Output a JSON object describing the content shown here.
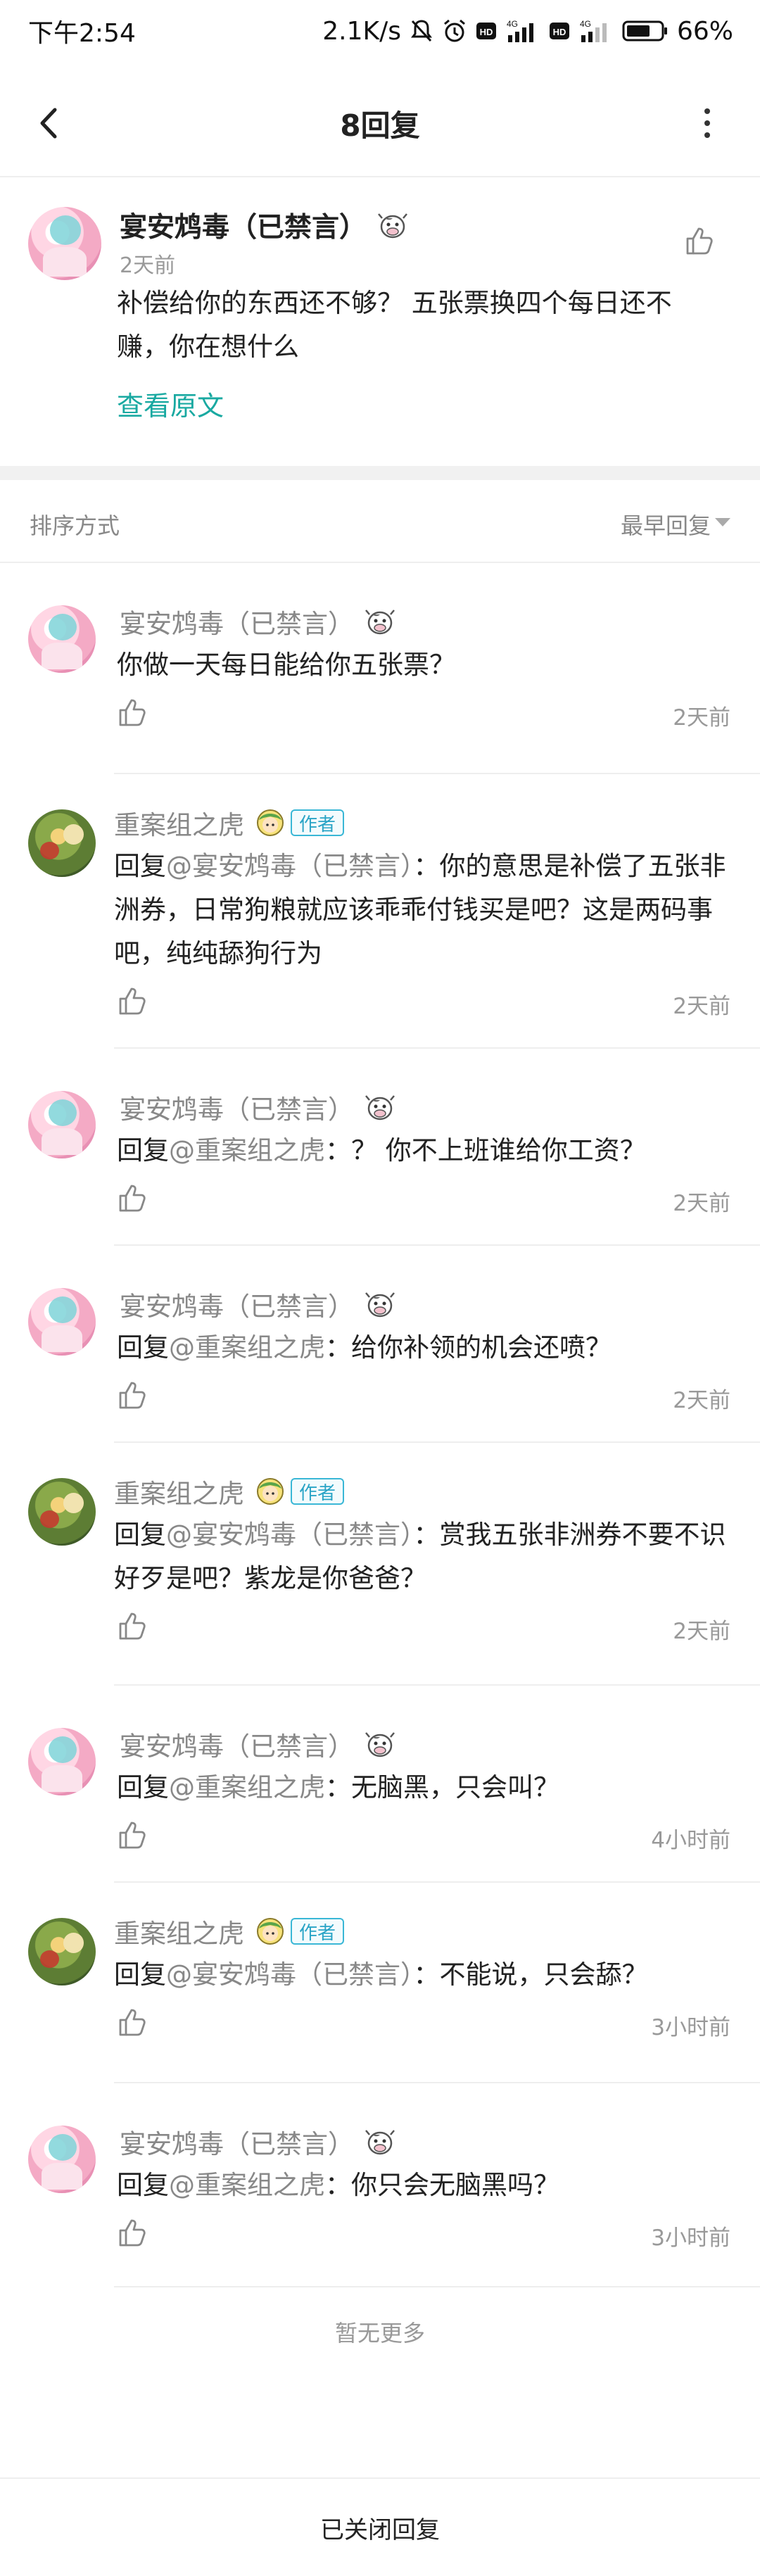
{
  "status_bar": {
    "time": "下午2:54",
    "speed": "2.1K/s",
    "battery": "66%",
    "icons": [
      "mute-icon",
      "alarm-icon",
      "hd-icon",
      "signal-4g-icon",
      "hd-icon",
      "signal-4g-icon",
      "battery-icon"
    ]
  },
  "nav": {
    "title": "8回复",
    "back_icon": "chevron-left-icon",
    "more_icon": "more-vertical-icon"
  },
  "main_comment": {
    "author": "宴安鸩毒（已禁言）",
    "time": "2天前",
    "text": "补偿给你的东西还不够？ 五张票换四个每日还不赚，你在想什么",
    "view_original": "查看原文"
  },
  "sort": {
    "label": "排序方式",
    "value": "最早回复"
  },
  "author_badge": "作者",
  "replies": [
    {
      "author": "宴安鸩毒（已禁言）",
      "prefix": "",
      "mention": "",
      "text": "你做一天每日能给你五张票？",
      "time": "2天前"
    },
    {
      "author": "重案组之虎",
      "prefix": "回复",
      "mention": "@宴安鸩毒（已禁言）",
      "text": "：你的意思是补偿了五张非洲券，日常狗粮就应该乖乖付钱买是吧？这是两码事吧，纯纯舔狗行为",
      "time": "2天前"
    },
    {
      "author": "宴安鸩毒（已禁言）",
      "prefix": "回复",
      "mention": "@重案组之虎",
      "text": "：？ 你不上班谁给你工资？",
      "time": "2天前"
    },
    {
      "author": "宴安鸩毒（已禁言）",
      "prefix": "回复",
      "mention": "@重案组之虎",
      "text": "：给你补领的机会还喷？",
      "time": "2天前"
    },
    {
      "author": "重案组之虎",
      "prefix": "回复",
      "mention": "@宴安鸩毒（已禁言）",
      "text": "：赏我五张非洲券不要不识好歹是吧？紫龙是你爸爸？",
      "time": "2天前"
    },
    {
      "author": "宴安鸩毒（已禁言）",
      "prefix": "回复",
      "mention": "@重案组之虎",
      "text": "：无脑黑，只会叫？",
      "time": "4小时前"
    },
    {
      "author": "重案组之虎",
      "prefix": "回复",
      "mention": "@宴安鸩毒（已禁言）",
      "text": "：不能说，只会舔？",
      "time": "3小时前"
    },
    {
      "author": "宴安鸩毒（已禁言）",
      "prefix": "回复",
      "mention": "@重案组之虎",
      "text": "：你只会无脑黑吗？",
      "time": "3小时前"
    }
  ],
  "no_more": "暂无更多",
  "bottom": "已关闭回复",
  "colors": {
    "accent": "#19a9a1",
    "badge": "#2aa4c6",
    "muted": "#888888"
  }
}
